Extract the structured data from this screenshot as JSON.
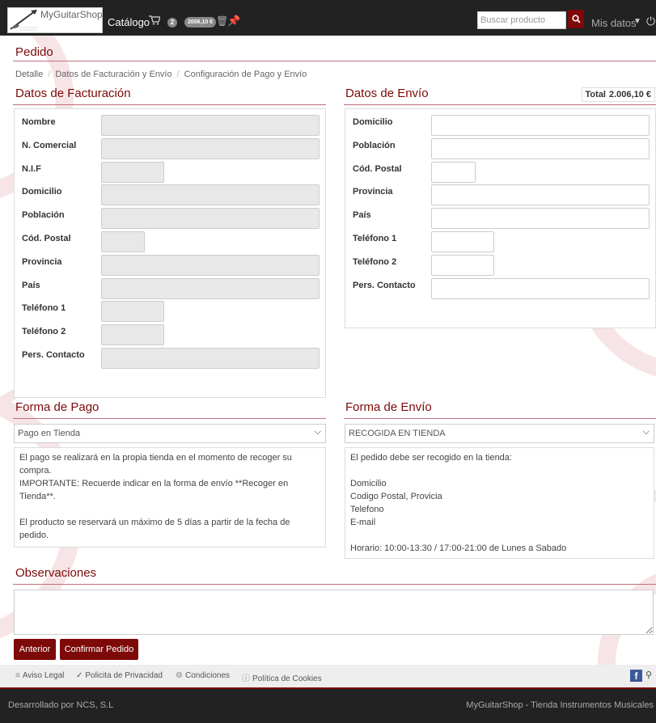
{
  "header": {
    "logo_text": "MyGuitarShop",
    "catalog_label": "Catálogo",
    "cart_count": "2",
    "cart_total": "2006,10 €",
    "search_placeholder": "Buscar producto",
    "account_label": "Mis datos"
  },
  "page": {
    "title": "Pedido",
    "breadcrumb": [
      "Detalle",
      "Datos de Facturación y Envío",
      "Configuración de Pago y Envío"
    ],
    "total_label": "Total",
    "total_value": "2.006,10 €"
  },
  "billing": {
    "title": "Datos de Facturación",
    "fields": [
      {
        "label": "Nombre",
        "value": ""
      },
      {
        "label": "N. Comercial",
        "value": ""
      },
      {
        "label": "N.I.F",
        "value": ""
      },
      {
        "label": "Domicilio",
        "value": ""
      },
      {
        "label": "Población",
        "value": ""
      },
      {
        "label": "Cód. Postal",
        "value": ""
      },
      {
        "label": "Provincia",
        "value": ""
      },
      {
        "label": "País",
        "value": ""
      },
      {
        "label": "Teléfono 1",
        "value": ""
      },
      {
        "label": "Teléfono 2",
        "value": ""
      },
      {
        "label": "Pers. Contacto",
        "value": ""
      }
    ]
  },
  "shipping": {
    "title": "Datos de Envío",
    "fields": [
      {
        "label": "Domicilio",
        "value": ""
      },
      {
        "label": "Población",
        "value": ""
      },
      {
        "label": "Cód. Postal",
        "value": ""
      },
      {
        "label": "Provincia",
        "value": ""
      },
      {
        "label": "País",
        "value": ""
      },
      {
        "label": "Teléfono 1",
        "value": ""
      },
      {
        "label": "Teléfono 2",
        "value": ""
      },
      {
        "label": "Pers. Contacto",
        "value": ""
      }
    ]
  },
  "payment": {
    "title": "Forma de Pago",
    "selected": "Pago en Tienda",
    "description": [
      "El pago se realizará en la propia tienda en el momento de recoger su",
      "compra.",
      "IMPORTANTE: Recuerde indicar en la forma de envío **Recoger en",
      "Tienda**.",
      "",
      "El producto se reservará un máximo de 5 días a partir de la fecha de",
      "pedido."
    ]
  },
  "delivery": {
    "title": "Forma de Envío",
    "selected": "RECOGIDA EN TIENDA",
    "description": [
      "El pedido debe ser recogido en la tienda:",
      "",
      "Domicilio",
      "Codigo Postal, Provicia",
      "Telefono",
      "E-mail",
      "",
      "Horario: 10:00-13:30 / 17:00-21:00 de Lunes a Sabado"
    ]
  },
  "observations": {
    "title": "Observaciones",
    "value": ""
  },
  "actions": {
    "back_label": "Anterior",
    "confirm_label": "Confirmar Pedido"
  },
  "footer": {
    "links": [
      "Aviso Legal",
      "Policita de Privacidad",
      "Condiciones",
      "Política de Cookies"
    ],
    "developed_by": "Desarrollado por NCS, S.L",
    "site_tagline": "MyGuitarShop - Tienda Instrumentos Musicales"
  },
  "colors": {
    "accent": "#7d0909",
    "navbar": "#222222",
    "readonly_input": "#e8e8e8"
  }
}
